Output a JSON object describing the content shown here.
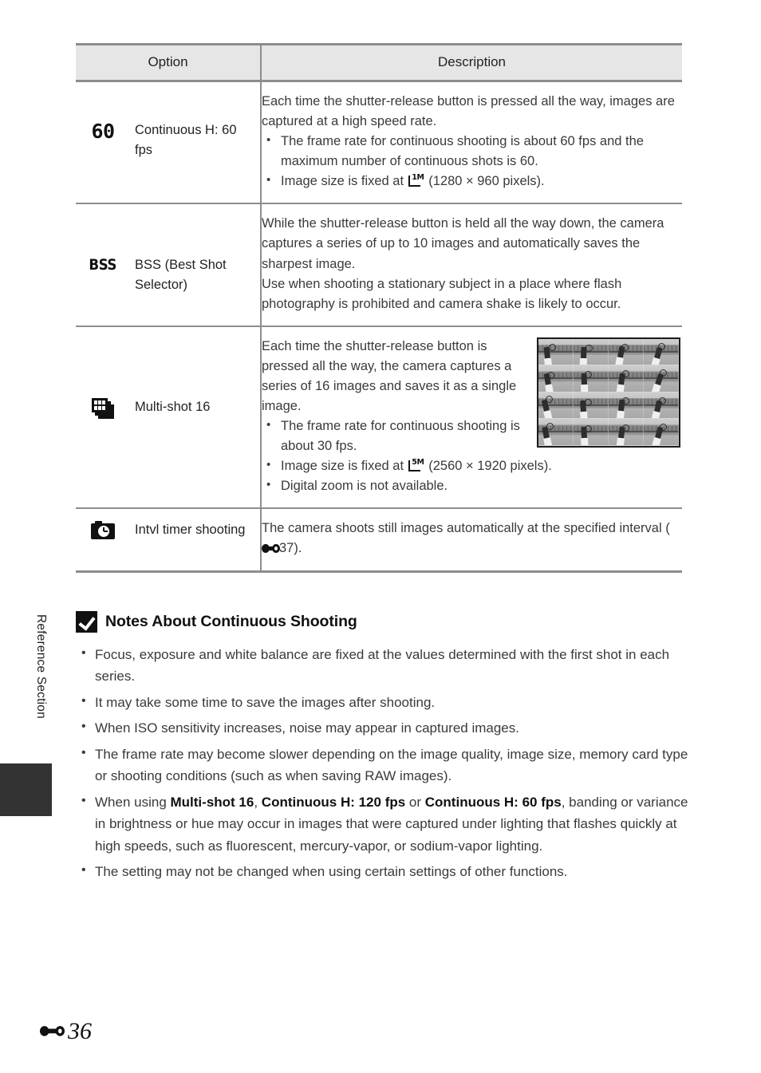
{
  "page": {
    "running_head": "Reference Section",
    "page_number": "36",
    "page_prefix_icon": "e-reference-icon"
  },
  "table": {
    "headers": {
      "option": "Option",
      "description": "Description"
    },
    "rows": [
      {
        "icon": "60-fps-icon",
        "icon_text": "60",
        "label": "Continuous H: 60 fps",
        "intro": [
          "Each time the shutter-release button is pressed all the way, images are captured at a high speed rate."
        ],
        "bullets": [
          {
            "text_before": "The frame rate for continuous shooting is about 60 fps and the maximum number of continuous shots is 60."
          },
          {
            "text_before": "Image size is fixed at ",
            "size_icon": "1M",
            "text_after": " (1280 × 960 pixels)."
          }
        ]
      },
      {
        "icon": "bss-icon",
        "icon_text": "BSS",
        "label": "BSS (Best Shot Selector)",
        "intro": [
          "While the shutter-release button is held all the way down, the camera captures a series of up to 10 images and automatically saves the sharpest image.",
          "Use when shooting a stationary subject in a place where flash photography is prohibited and camera shake is likely to occur."
        ],
        "bullets": []
      },
      {
        "icon": "multi-shot-icon",
        "icon_text": "",
        "label": "Multi-shot 16",
        "intro": [
          "Each time the shutter-release button is pressed all the way, the camera captures a series of 16 images and saves it as a single image."
        ],
        "bullets": [
          {
            "text_before": "The frame rate for continuous shooting is about 30 fps."
          },
          {
            "text_before": "Image size is fixed at ",
            "size_icon": "5M",
            "text_after": " (2560 × 1920 pixels)."
          },
          {
            "text_before": "Digital zoom is not available."
          }
        ],
        "thumbnail_alt": "multi-shot-16-sample-image"
      },
      {
        "icon": "intvl-timer-icon",
        "icon_text": "",
        "label": "Intvl timer shooting",
        "intro": [
          "The camera shoots still images automatically at the specified interval (·37)."
        ],
        "intro_ref": {
          "text_before": "The camera shoots still images automatically at the specified interval (",
          "ref_icon": "e-reference-icon",
          "ref_page": "37",
          "text_after": ")."
        },
        "bullets": []
      }
    ]
  },
  "notes": {
    "icon": "check-badge-icon",
    "title": "Notes About Continuous Shooting",
    "items": [
      {
        "parts": [
          {
            "t": "Focus, exposure and white balance are fixed at the values determined with the first shot in each series."
          }
        ]
      },
      {
        "parts": [
          {
            "t": "It may take some time to save the images after shooting."
          }
        ]
      },
      {
        "parts": [
          {
            "t": "When ISO sensitivity increases, noise may appear in captured images."
          }
        ]
      },
      {
        "parts": [
          {
            "t": "The frame rate may become slower depending on the image quality, image size, memory card type or shooting conditions (such as when saving RAW images)."
          }
        ]
      },
      {
        "parts": [
          {
            "t": "When using "
          },
          {
            "t": "Multi-shot 16",
            "b": true
          },
          {
            "t": ", "
          },
          {
            "t": "Continuous H: 120 fps",
            "b": true
          },
          {
            "t": " or "
          },
          {
            "t": "Continuous H: 60 fps",
            "b": true
          },
          {
            "t": ", banding or variance in brightness or hue may occur in images that were captured under lighting that flashes quickly at high speeds, such as fluorescent, mercury-vapor, or sodium-vapor lighting."
          }
        ]
      },
      {
        "parts": [
          {
            "t": "The setting may not be changed when using certain settings of other functions."
          }
        ]
      }
    ]
  },
  "colors": {
    "rule": "#8d8d8d",
    "header_bg": "#e6e6e6",
    "body_text": "#3a3a3a",
    "heading_text": "#111111",
    "tab_block": "#333333"
  }
}
